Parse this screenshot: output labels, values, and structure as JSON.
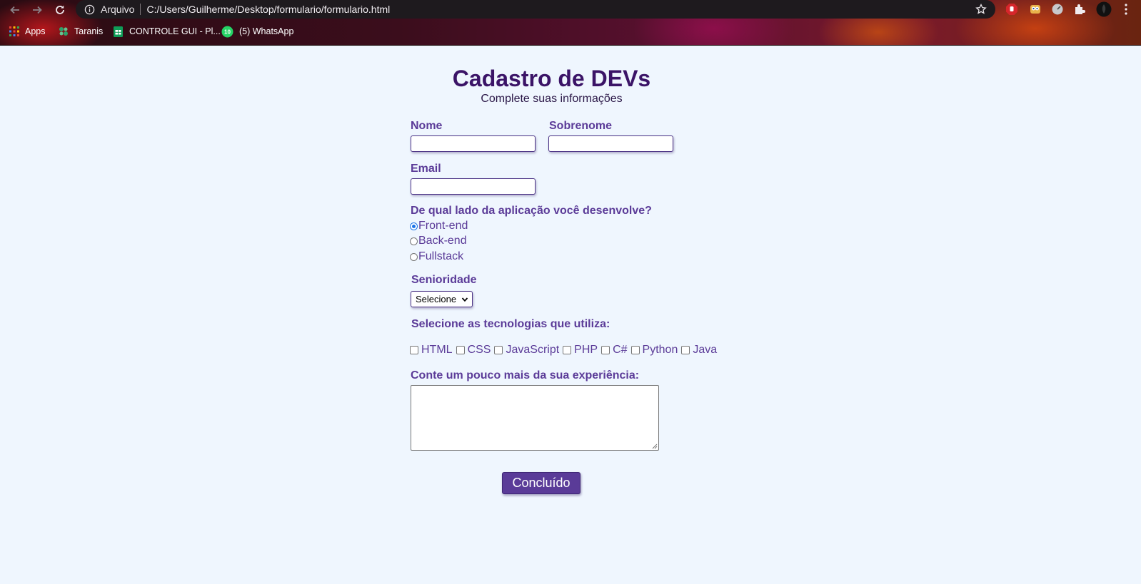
{
  "browser": {
    "omnibox": {
      "scheme_label": "Arquivo",
      "url": "C:/Users/Guilherme/Desktop/formulario/formulario.html"
    },
    "bookmarks": [
      {
        "label": "Apps",
        "icon": "apps-grid-icon"
      },
      {
        "label": "Taranis",
        "icon": "taranis-icon"
      },
      {
        "label": "CONTROLE GUI - Pl...",
        "icon": "sheets-icon"
      },
      {
        "label": "(5) WhatsApp",
        "icon": "whatsapp-icon",
        "badge": "10"
      }
    ]
  },
  "form": {
    "title": "Cadastro de DEVs",
    "subtitle": "Complete suas informações",
    "nome_label": "Nome",
    "nome_value": "",
    "sobrenome_label": "Sobrenome",
    "sobrenome_value": "",
    "email_label": "Email",
    "email_value": "",
    "side_question": "De qual lado da aplicação você desenvolve?",
    "side_options": [
      {
        "label": "Front-end",
        "checked": true
      },
      {
        "label": "Back-end",
        "checked": false
      },
      {
        "label": "Fullstack",
        "checked": false
      }
    ],
    "seniority_label": "Senioridade",
    "seniority_selected": "Selecione",
    "tech_question": "Selecione as tecnologias que utiliza:",
    "technologies": [
      "HTML",
      "CSS",
      "JavaScript",
      "PHP",
      "C#",
      "Python",
      "Java"
    ],
    "experience_label": "Conte um pouco mais da sua experiência:",
    "experience_value": "",
    "submit_label": "Concluído"
  },
  "colors": {
    "page_background": "#eff6fe",
    "title": "#3b1467",
    "label": "#5b3b98",
    "button": "#5a3b98",
    "radio_checked": "#1a73e8"
  }
}
